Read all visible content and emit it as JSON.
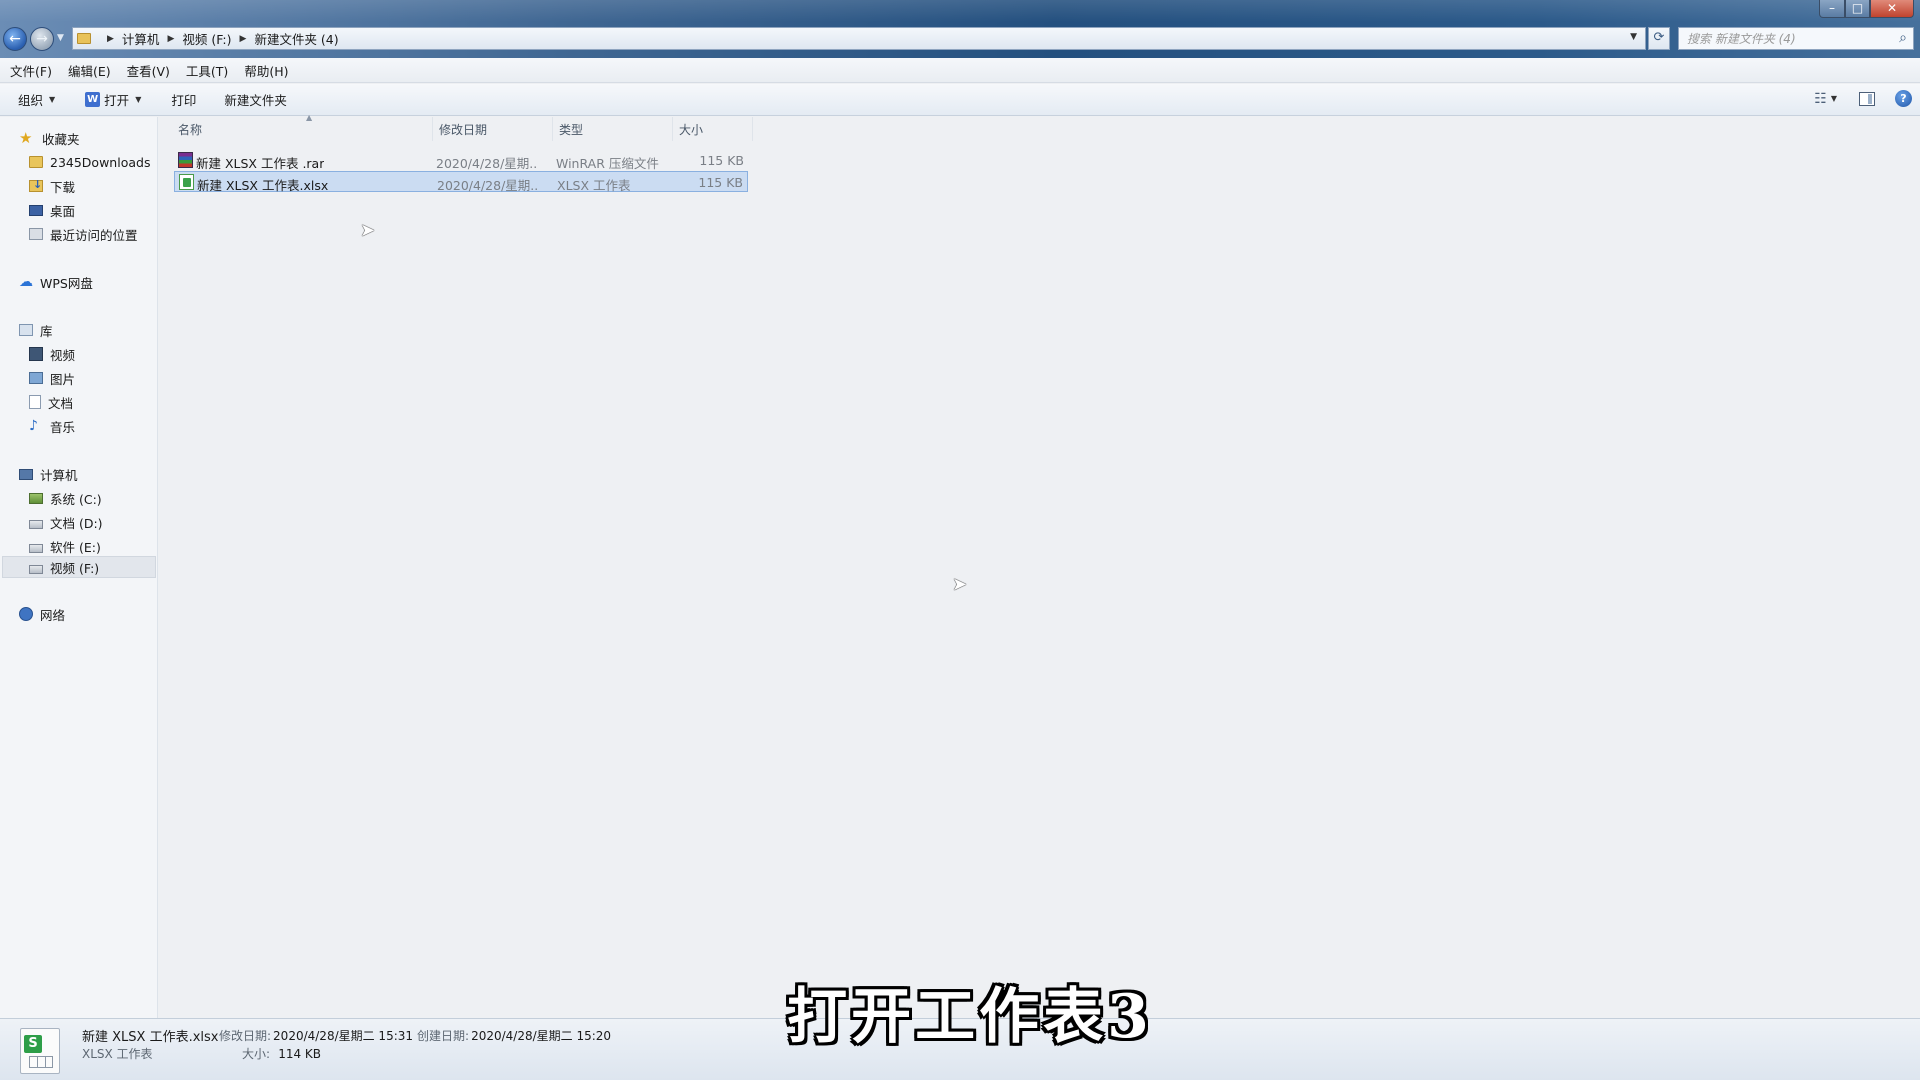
{
  "window": {
    "caption_buttons": {
      "minimize": "–",
      "maximize": "□",
      "close": "✕"
    }
  },
  "address_bar": {
    "breadcrumbs": [
      "计算机",
      "视频 (F:)",
      "新建文件夹 (4)"
    ]
  },
  "search": {
    "placeholder": "搜索 新建文件夹 (4)"
  },
  "menu": [
    "文件(F)",
    "编辑(E)",
    "查看(V)",
    "工具(T)",
    "帮助(H)"
  ],
  "toolbar": {
    "organize": "组织",
    "open": "打开",
    "open_icon_letter": "W",
    "print": "打印",
    "new_folder": "新建文件夹",
    "help_glyph": "?"
  },
  "sidebar": {
    "favorites": "收藏夹",
    "favorite_items": [
      "2345Downloads",
      "下载",
      "桌面",
      "最近访问的位置"
    ],
    "wps_cloud": "WPS网盘",
    "libraries": "库",
    "library_items": [
      "视频",
      "图片",
      "文档",
      "音乐"
    ],
    "computer": "计算机",
    "drives": [
      "系统 (C:)",
      "文档 (D:)",
      "软件 (E:)",
      "视频 (F:)"
    ],
    "selected_drive": "视频 (F:)",
    "network": "网络"
  },
  "columns": [
    "名称",
    "修改日期",
    "类型",
    "大小"
  ],
  "files": [
    {
      "name": "新建 XLSX 工作表 .rar",
      "date": "2020/4/28/星期...",
      "type": "WinRAR 压缩文件",
      "size": "115 KB",
      "icon": "rar-icon"
    },
    {
      "name": "新建 XLSX 工作表.xlsx",
      "date": "2020/4/28/星期...",
      "type": "XLSX 工作表",
      "size": "115 KB",
      "icon": "xlsx-icon",
      "selected": true
    }
  ],
  "details": {
    "file_name": "新建 XLSX 工作表.xlsx",
    "modified_label": "修改日期:",
    "modified_value": "2020/4/28/星期二 15:31",
    "created_label": "创建日期:",
    "created_value": "2020/4/28/星期二 15:20",
    "file_type": "XLSX 工作表",
    "size_label": "大小:",
    "size_value": "114 KB",
    "icon_letter": "S"
  },
  "subtitle": "打开工作表3"
}
